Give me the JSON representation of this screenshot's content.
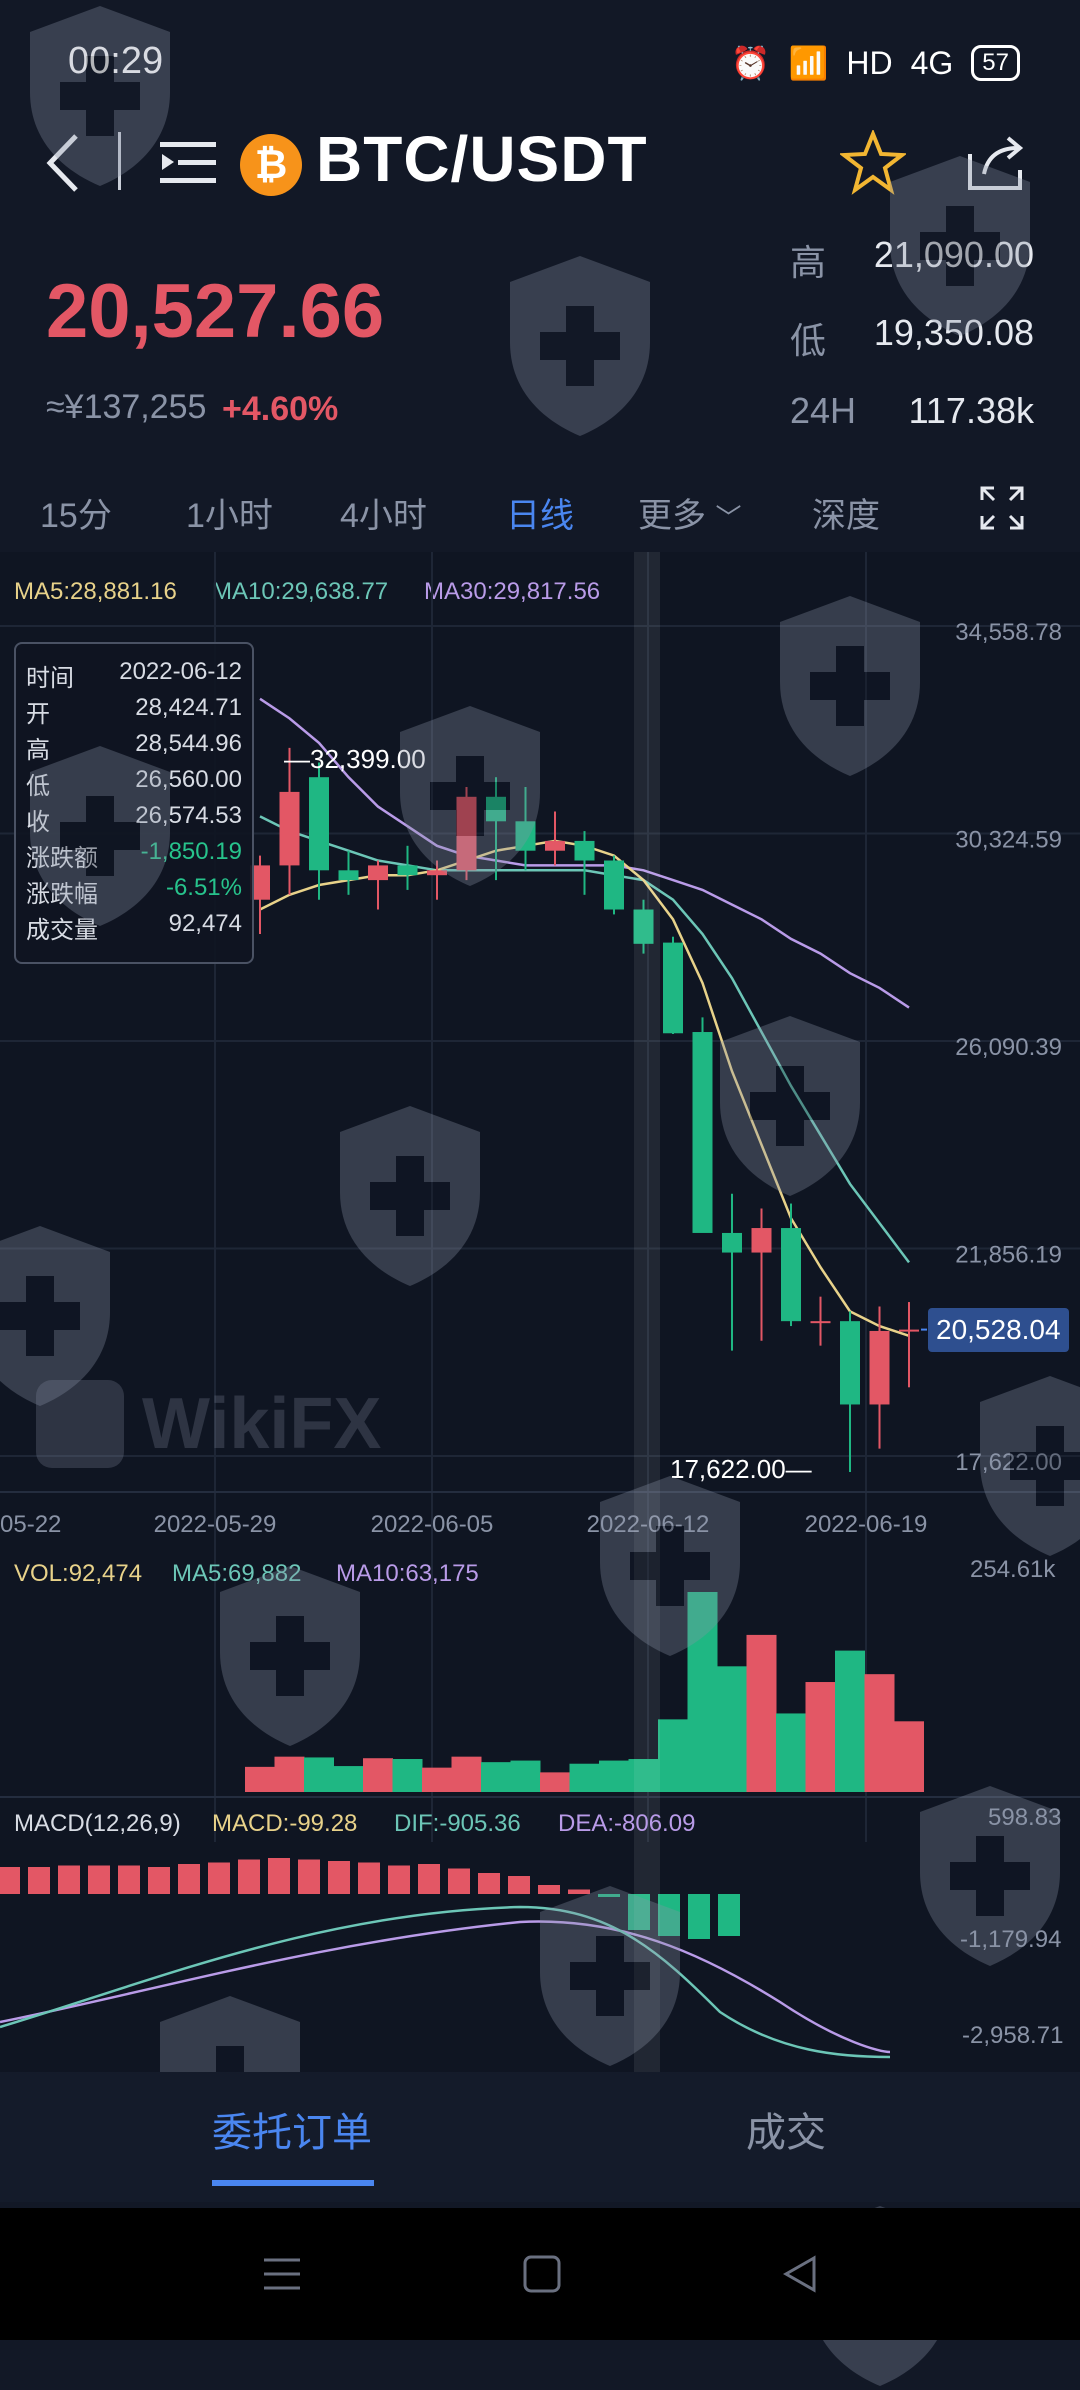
{
  "status_bar": {
    "time": "00:29",
    "net": "HD",
    "sig": "4G",
    "battery": "57"
  },
  "header": {
    "pair": "BTC/USDT",
    "coin_symbol": "₿"
  },
  "price": {
    "last": "20,527.66",
    "cny": "≈¥137,255",
    "change": "+4.60%"
  },
  "stats": [
    {
      "label": "高",
      "value": "21,090.00"
    },
    {
      "label": "低",
      "value": "19,350.08"
    },
    {
      "label": "24H",
      "value": "117.38k"
    }
  ],
  "tabs": [
    "15分",
    "1小时",
    "4小时",
    "日线",
    "更多",
    "深度"
  ],
  "active_tab": "日线",
  "ma_legend": {
    "ma5": "MA5:28,881.16",
    "ma10": "MA10:29,638.77",
    "ma30": "MA30:29,817.56"
  },
  "tooltip": [
    {
      "k": "时间",
      "v": "2022-06-12"
    },
    {
      "k": "开",
      "v": "28,424.71"
    },
    {
      "k": "高",
      "v": "28,544.96"
    },
    {
      "k": "低",
      "v": "26,560.00"
    },
    {
      "k": "收",
      "v": "26,574.53"
    },
    {
      "k": "涨跌额",
      "v": "-1,850.19"
    },
    {
      "k": "涨跌幅",
      "v": "-6.51%"
    },
    {
      "k": "成交量",
      "v": "92,474"
    }
  ],
  "annotations": {
    "high": "32,399.00",
    "low": "17,622.00",
    "last_tag": "20,528.04"
  },
  "vol_legend": {
    "vol": "VOL:92,474",
    "ma5": "MA5:69,882",
    "ma10": "MA10:63,175",
    "max": "254.61k"
  },
  "macd_legend": {
    "title": "MACD(12,26,9)",
    "macd": "MACD:-99.28",
    "dif": "DIF:-905.36",
    "dea": "DEA:-806.09"
  },
  "macd_axis": [
    "598.83",
    "-1,179.94",
    "-2,958.71"
  ],
  "bottom_tabs": [
    "委托订单",
    "成交"
  ],
  "watermark": "WikiFX",
  "colors": {
    "up": "#e35765",
    "down": "#1fb783",
    "ma5": "#e8d28a",
    "ma10": "#6cc6b7",
    "ma30": "#b99be8",
    "accent": "#4a86f0"
  },
  "chart_data": {
    "type": "candlestick",
    "y_axis": [
      34558.78,
      30324.59,
      26090.39,
      21856.19,
      17622.0
    ],
    "x_labels": [
      "05-22",
      "2022-05-29",
      "2022-06-05",
      "2022-06-12",
      "2022-06-19"
    ],
    "candles": [
      {
        "o": 29300,
        "h": 30200,
        "l": 28600,
        "c": 30000
      },
      {
        "o": 30000,
        "h": 32399,
        "l": 29400,
        "c": 31500
      },
      {
        "o": 31800,
        "h": 32100,
        "l": 29300,
        "c": 29900
      },
      {
        "o": 29900,
        "h": 30300,
        "l": 29400,
        "c": 29700
      },
      {
        "o": 29700,
        "h": 30100,
        "l": 29100,
        "c": 30000
      },
      {
        "o": 30000,
        "h": 30400,
        "l": 29500,
        "c": 29800
      },
      {
        "o": 29800,
        "h": 30100,
        "l": 29300,
        "c": 29900
      },
      {
        "o": 29900,
        "h": 31600,
        "l": 29700,
        "c": 31400
      },
      {
        "o": 31400,
        "h": 31800,
        "l": 29700,
        "c": 30900
      },
      {
        "o": 30900,
        "h": 31600,
        "l": 29900,
        "c": 30300
      },
      {
        "o": 30300,
        "h": 31100,
        "l": 30000,
        "c": 30500
      },
      {
        "o": 30500,
        "h": 30700,
        "l": 29400,
        "c": 30100
      },
      {
        "o": 30100,
        "h": 30200,
        "l": 29000,
        "c": 29100
      },
      {
        "o": 29100,
        "h": 29300,
        "l": 28200,
        "c": 28400
      },
      {
        "o": 28424.71,
        "h": 28544.96,
        "l": 26560,
        "c": 26574.53
      },
      {
        "o": 26600,
        "h": 26900,
        "l": 22600,
        "c": 22500
      },
      {
        "o": 22500,
        "h": 23300,
        "l": 20100,
        "c": 22100
      },
      {
        "o": 22100,
        "h": 23000,
        "l": 20300,
        "c": 22600
      },
      {
        "o": 22600,
        "h": 23100,
        "l": 20600,
        "c": 20700
      },
      {
        "o": 20700,
        "h": 21200,
        "l": 20200,
        "c": 20700
      },
      {
        "o": 20700,
        "h": 20900,
        "l": 17622,
        "c": 19000
      },
      {
        "o": 19000,
        "h": 21000,
        "l": 18100,
        "c": 20500
      },
      {
        "o": 20500,
        "h": 21090,
        "l": 19350.08,
        "c": 20527.66
      }
    ],
    "ma5": [
      29100,
      29400,
      29600,
      29700,
      29800,
      29800,
      29900,
      30100,
      30300,
      30400,
      30500,
      30400,
      30200,
      29700,
      28900,
      27600,
      25800,
      24300,
      22800,
      21800,
      20900,
      20600,
      20400
    ],
    "ma10": [
      31000,
      30700,
      30500,
      30300,
      30100,
      30000,
      29900,
      29900,
      29900,
      29900,
      29900,
      29900,
      29800,
      29700,
      29300,
      28600,
      27700,
      26600,
      25500,
      24500,
      23500,
      22700,
      21900
    ],
    "ma30": [
      33400,
      33000,
      32500,
      31800,
      31200,
      30800,
      30400,
      30200,
      30100,
      30000,
      30000,
      30000,
      30000,
      29900,
      29700,
      29500,
      29200,
      28900,
      28500,
      28200,
      27800,
      27500,
      27100
    ],
    "volume": [
      32000,
      45000,
      44000,
      33000,
      43000,
      42000,
      31000,
      45000,
      38000,
      40000,
      25000,
      36000,
      40000,
      42000,
      92474,
      254610,
      160000,
      200000,
      100000,
      140000,
      180000,
      150000,
      90000
    ],
    "macd_hist": [
      900,
      900,
      950,
      950,
      950,
      900,
      1000,
      1050,
      1150,
      1200,
      1150,
      1100,
      1050,
      950,
      1000,
      850,
      700,
      600,
      300,
      150,
      -100,
      -1200,
      -1400,
      -1500,
      -1400
    ]
  }
}
